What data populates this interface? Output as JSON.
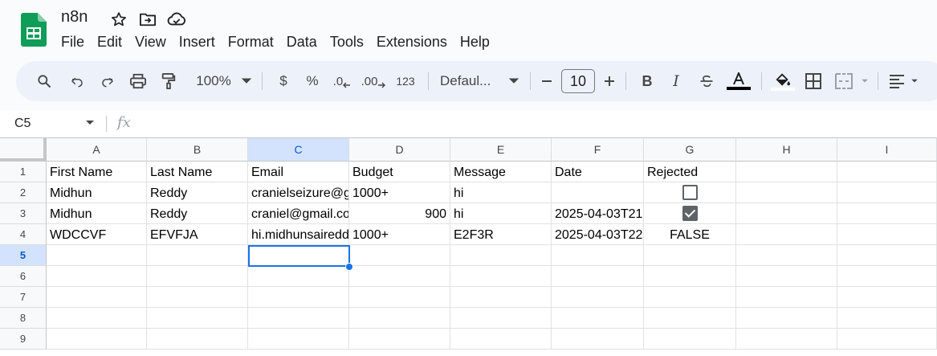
{
  "app": {
    "doc_title": "n8n",
    "menu": [
      "File",
      "Edit",
      "View",
      "Insert",
      "Format",
      "Data",
      "Tools",
      "Extensions",
      "Help"
    ]
  },
  "toolbar": {
    "zoom": "100%",
    "currency": "$",
    "percent": "%",
    "decrease_decimal": ".0",
    "increase_decimal": ".00",
    "number_format": "123",
    "font": "Defaul...",
    "font_size": "10",
    "bold": "B",
    "italic": "I"
  },
  "formula_bar": {
    "name_box": "C5",
    "fx": "fx",
    "value": ""
  },
  "sheet": {
    "columns": [
      "A",
      "B",
      "C",
      "D",
      "E",
      "F",
      "G",
      "H",
      "I"
    ],
    "selected_column": "C",
    "rows": [
      "1",
      "2",
      "3",
      "4",
      "5",
      "6",
      "7",
      "8",
      "9"
    ],
    "selected_row": "5",
    "data": [
      [
        "First Name",
        "Last Name",
        "Email",
        "Budget",
        "Message",
        "Date",
        "Rejected",
        "",
        ""
      ],
      [
        "Midhun",
        "Reddy",
        "cranielseizure@gmail.com",
        "1000+",
        "hi",
        "",
        "[unchecked]",
        "",
        ""
      ],
      [
        "Midhun",
        "Reddy",
        "craniel@gmail.com",
        "900",
        "hi",
        "2025-04-03T21",
        "[checked]",
        "",
        ""
      ],
      [
        "WDCCVF",
        "EFVFJA",
        "hi.midhunsairedd",
        "1000+",
        "E2F3R",
        "2025-04-03T22",
        "FALSE",
        "",
        ""
      ],
      [
        "",
        "",
        "",
        "",
        "",
        "",
        "",
        "",
        ""
      ]
    ]
  },
  "colors": {
    "accent": "#1a73e8",
    "sheets_green": "#0f9d58",
    "header_bg": "#f8f9fa",
    "selected_header_bg": "#d3e3fd"
  }
}
